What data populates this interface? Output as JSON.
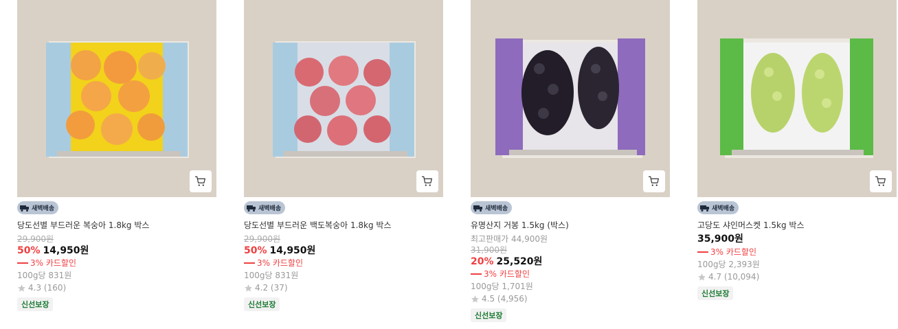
{
  "products": [
    {
      "badge": "새벽배송",
      "name": "당도선별 부드러운 복숭아 1.8kg 박스",
      "original_price": "29,900원",
      "discount_rate": "50%",
      "price": "14,950원",
      "card_discount": "3% 카드할인",
      "unit_price": "100g당 831원",
      "rating": "4.3 (160)",
      "fresh_tag": "신선보장",
      "image": "yellow-peach-box",
      "box_color": "#a9cbe0"
    },
    {
      "badge": "새벽배송",
      "name": "당도선별 부드러운 백도복숭아 1.8kg 박스",
      "original_price": "29,900원",
      "discount_rate": "50%",
      "price": "14,950원",
      "card_discount": "3% 카드할인",
      "unit_price": "100g당 831원",
      "rating": "4.2 (37)",
      "fresh_tag": "신선보장",
      "image": "white-peach-box",
      "box_color": "#a9cbe0"
    },
    {
      "badge": "새벽배송",
      "name": "유명산지 거봉 1.5kg (박스)",
      "max_retail_price": "최고판매가 44,900원",
      "original_price": "31,900원",
      "discount_rate": "20%",
      "price": "25,520원",
      "card_discount": "3% 카드할인",
      "unit_price": "100g당 1,701원",
      "rating": "4.5 (4,956)",
      "fresh_tag": "신선보장",
      "image": "grape-box",
      "box_color": "#8e6bbd"
    },
    {
      "badge": "새벽배송",
      "name": "고당도 샤인머스켓 1.5kg 박스",
      "price": "35,900원",
      "card_discount": "3% 카드할인",
      "unit_price": "100g당 2,393원",
      "rating": "4.7 (10,094)",
      "fresh_tag": "신선보장",
      "image": "shine-muscat-box",
      "box_color": "#5cba47"
    }
  ],
  "icons": {
    "cart": "cart-icon",
    "truck": "truck-icon",
    "star": "star-icon"
  },
  "colors": {
    "discount_red": "#f03f40",
    "fresh_green": "#1c7a33",
    "badge_bg": "#b9c5d4"
  }
}
